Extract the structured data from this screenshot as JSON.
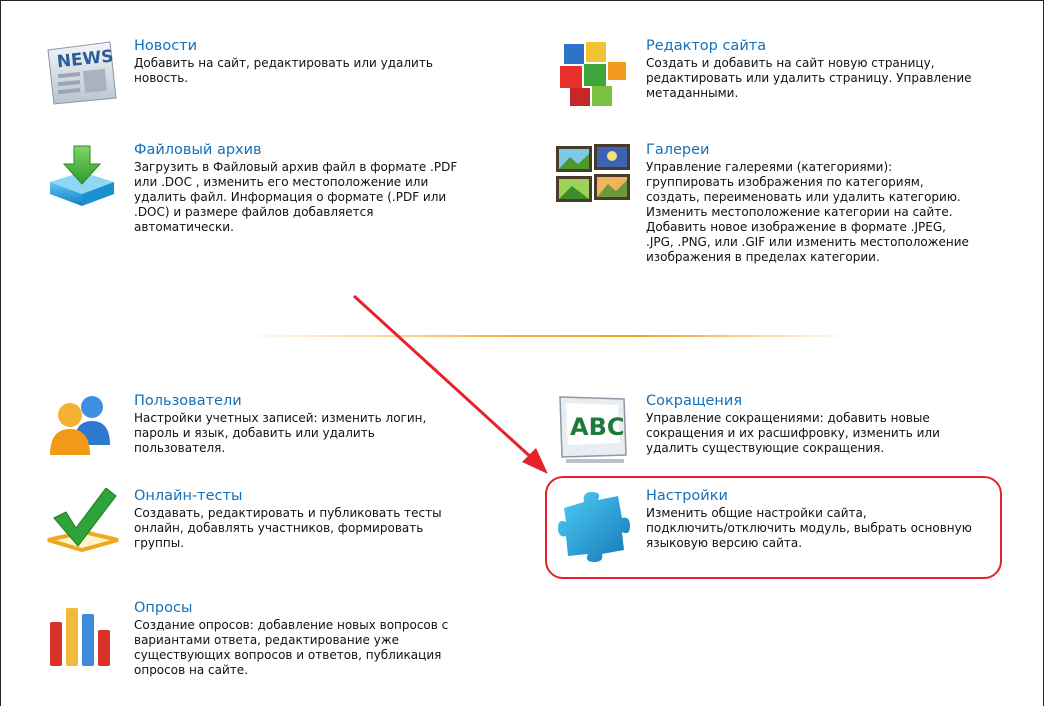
{
  "modules": {
    "news": {
      "title": "Новости",
      "desc": [
        "Добавить на сайт, редактировать или удалить",
        "новость."
      ],
      "icon": "news-icon",
      "icon_text": "NEWS"
    },
    "files": {
      "title": "Файловый архив",
      "desc": [
        "Загрузить в Файловый архив файл в формате .PDF",
        "или .DOC , изменить его местоположение или",
        "удалить файл. Информация о формате (.PDF или",
        ".DOC) и размере файлов добавляется",
        "автоматически."
      ],
      "icon": "download-arrow-icon"
    },
    "editor": {
      "title": "Редактор сайта",
      "desc": [
        "Создать и добавить на сайт новую страницу,",
        "редактировать или удалить страницу. Управление",
        "метаданными."
      ],
      "icon": "colored-cubes-icon"
    },
    "galleries": {
      "title": "Галереи",
      "desc": [
        "Управление галереями (категориями):",
        "группировать изображения по категориям,",
        "создать, переименовать или удалить категорию.",
        "Изменить местоположение категории на сайте.",
        "Добавить новое изображение в формате .JPEG,",
        ".JPG, .PNG, или .GIF или изменить местоположение",
        "изображения в пределах категории."
      ],
      "icon": "gallery-icon"
    },
    "users": {
      "title": "Пользователи",
      "desc": [
        "Настройки учетных записей: изменить логин,",
        "пароль и язык, добавить или удалить",
        "пользователя."
      ],
      "icon": "users-icon"
    },
    "tests": {
      "title": "Онлайн-тесты",
      "desc": [
        "Создавать, редактировать и публиковать тесты",
        "онлайн, добавлять участников, формировать",
        "группы."
      ],
      "icon": "checkmark-icon"
    },
    "polls": {
      "title": "Опросы",
      "desc": [
        "Создание опросов: добавление новых вопросов с",
        "вариантами ответа, редактирование уже",
        "существующих вопросов и ответов, публикация",
        "опросов на сайте."
      ],
      "icon": "bar-chart-icon"
    },
    "abbreviations": {
      "title": "Сокращения",
      "desc": [
        "Управление сокращениями: добавить новые",
        "сокращения и их расшифровку, изменить или",
        "удалить существующие сокращения."
      ],
      "icon": "abc-board-icon",
      "icon_text": "ABC"
    },
    "settings": {
      "title": "Настройки",
      "desc": [
        "Изменить общие настройки сайта,",
        "подключить/отключить модуль, выбрать основную",
        "языковую версию сайта."
      ],
      "icon": "puzzle-piece-icon"
    }
  },
  "annotation": {
    "highlight_color": "#e8202a",
    "arrow_color": "#e8202a",
    "highlighted_module": "settings"
  },
  "colors": {
    "title_link": "#1570b8",
    "separator": "#f6b13d"
  }
}
